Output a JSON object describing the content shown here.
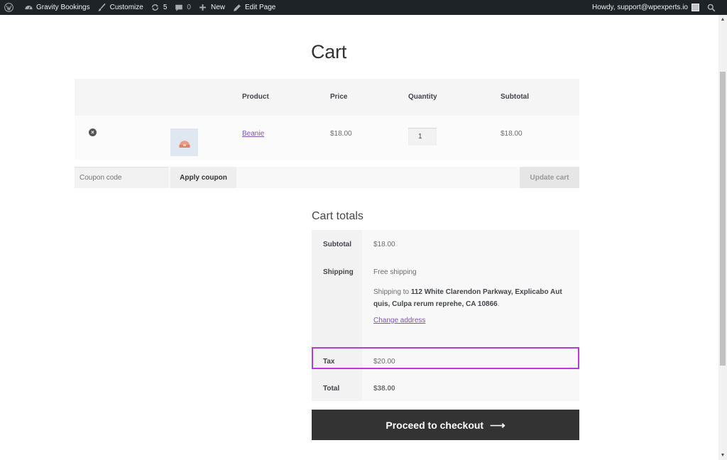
{
  "adminbar": {
    "site_name": "Gravity Bookings",
    "customize": "Customize",
    "updates_count": "5",
    "comments_count": "0",
    "new": "New",
    "edit_page": "Edit Page",
    "howdy": "Howdy, support@wpexperts.io",
    "icons": [
      "wordpress-logo-icon",
      "dashboard-icon",
      "brush-icon",
      "refresh-icon",
      "comment-icon",
      "plus-icon",
      "pencil-icon",
      "avatar",
      "search-icon"
    ]
  },
  "page": {
    "title": "Cart"
  },
  "cart_table": {
    "headers": {
      "product": "Product",
      "price": "Price",
      "quantity": "Quantity",
      "subtotal": "Subtotal"
    },
    "rows": [
      {
        "product": "Beanie",
        "price": "$18.00",
        "quantity": "1",
        "subtotal": "$18.00"
      }
    ]
  },
  "actions": {
    "coupon_placeholder": "Coupon code",
    "apply_coupon": "Apply coupon",
    "update_cart": "Update cart"
  },
  "totals": {
    "title": "Cart totals",
    "subtotal_label": "Subtotal",
    "subtotal_value": "$18.00",
    "shipping_label": "Shipping",
    "shipping_method": "Free shipping",
    "shipping_to_prefix": "Shipping to ",
    "shipping_address": "112 White Clarendon Parkway, Explicabo Aut quis, Culpa rerum reprehe, CA 10866",
    "shipping_to_suffix": ".",
    "change_address": "Change address",
    "tax_label": "Tax",
    "tax_value": "$20.00",
    "total_label": "Total",
    "total_value": "$38.00"
  },
  "checkout": {
    "label": "Proceed to checkout",
    "arrow": "⟶"
  },
  "colors": {
    "adminbar_bg": "#1d2327",
    "link": "#7f54b3",
    "highlight": "#b63cd6",
    "checkout_bg": "#333333"
  }
}
